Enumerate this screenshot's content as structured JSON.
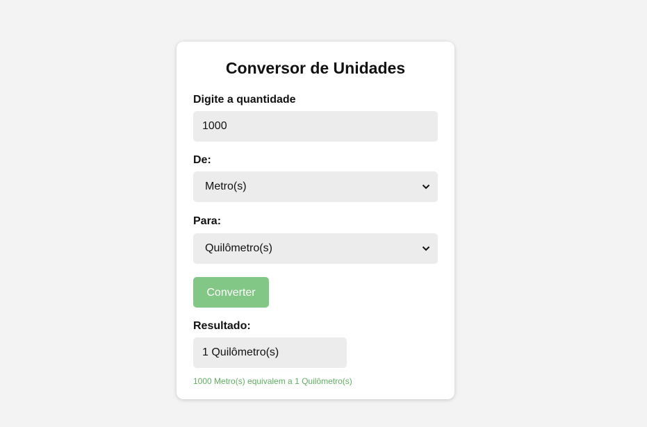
{
  "converter": {
    "title": "Conversor de Unidades",
    "quantity_label": "Digite a quantidade",
    "quantity_value": "1000",
    "from_label": "De:",
    "from_selected": "Metro(s)",
    "to_label": "Para:",
    "to_selected": "Quilômetro(s)",
    "convert_button": "Converter",
    "result_label": "Resultado:",
    "result_value": "1 Quilômetro(s)",
    "result_note": "1000 Metro(s) equivalem a 1 Quilômetro(s)"
  },
  "colors": {
    "background": "#f3f3f3",
    "card": "#ffffff",
    "field": "#ececec",
    "button": "#82c785",
    "note": "#5fae62"
  },
  "icons": {
    "select_arrow": "chevron-down-icon"
  }
}
